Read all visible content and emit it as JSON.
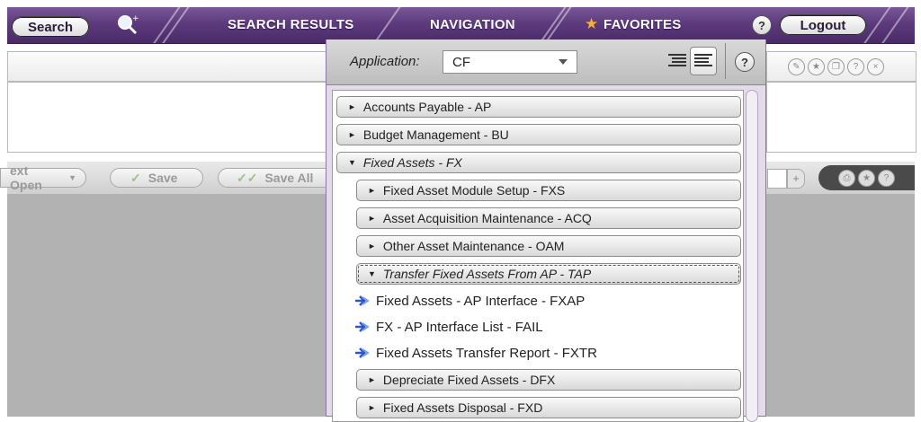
{
  "topbar": {
    "search_label": "Search",
    "tabs": [
      "SEARCH RESULTS",
      "NAVIGATION",
      "FAVORITES"
    ],
    "help_label": "?",
    "logout_label": "Logout"
  },
  "toolbar": {
    "next_open_label": "ext Open",
    "save_label": "Save",
    "save_all_label": "Save All"
  },
  "navigation": {
    "application_label": "Application:",
    "application_value": "CF",
    "help_label": "?",
    "items": [
      {
        "label": "Accounts Payable - AP",
        "level": 1,
        "expanded": false
      },
      {
        "label": "Budget Management - BU",
        "level": 1,
        "expanded": false
      },
      {
        "label": "Fixed Assets - FX",
        "level": 1,
        "expanded": true
      },
      {
        "label": "Fixed Asset Module Setup - FXS",
        "level": 2,
        "expanded": false
      },
      {
        "label": "Asset Acquisition Maintenance - ACQ",
        "level": 2,
        "expanded": false
      },
      {
        "label": "Other Asset Maintenance - OAM",
        "level": 2,
        "expanded": false
      },
      {
        "label": "Transfer Fixed Assets From AP - TAP",
        "level": 2,
        "expanded": true
      },
      {
        "label": "Fixed Assets - AP Interface - FXAP",
        "level": 3
      },
      {
        "label": "FX - AP Interface List - FAIL",
        "level": 3
      },
      {
        "label": "Fixed Assets Transfer Report - FXTR",
        "level": 3
      },
      {
        "label": "Depreciate Fixed Assets - DFX",
        "level": 2,
        "expanded": false
      },
      {
        "label": "Fixed Assets Disposal - FXD",
        "level": 2,
        "expanded": false
      }
    ]
  },
  "colors": {
    "brand_purple": "#5d3a7d",
    "accent_star": "#f2b233"
  }
}
